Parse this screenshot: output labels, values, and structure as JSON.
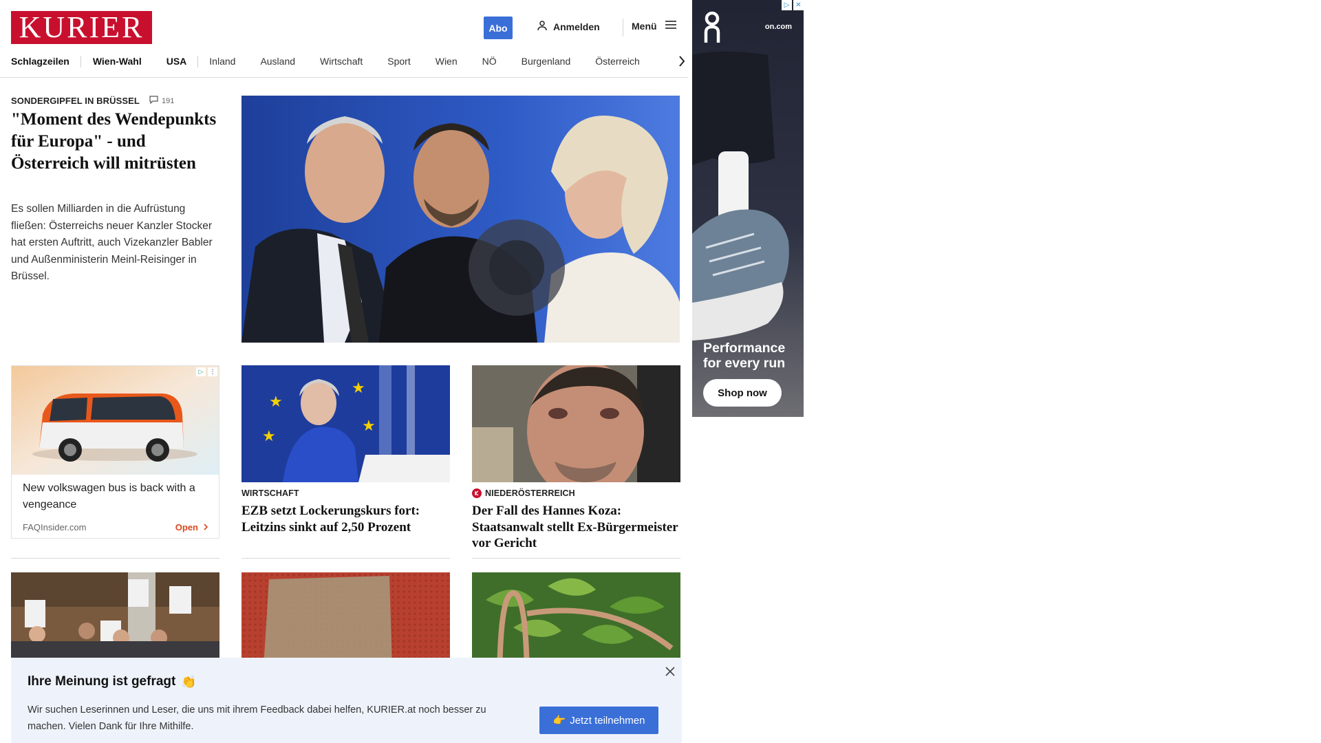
{
  "header": {
    "logo_text": "KURIER",
    "abo_label": "Abo",
    "login_label": "Anmelden",
    "menu_label": "Menü"
  },
  "nav": {
    "items": [
      "Schlagzeilen",
      "Wien-Wahl",
      "USA",
      "Inland",
      "Ausland",
      "Wirtschaft",
      "Sport",
      "Wien",
      "NÖ",
      "Burgenland",
      "Österreich"
    ]
  },
  "lead": {
    "kicker": "SONDERGIPFEL IN BRÜSSEL",
    "comment_count": "191",
    "title": "\"Moment des Wendepunkts für Europa\" - und Österreich will mitrüsten",
    "teaser": "Es sollen Milliarden in die Aufrüstung fließen: Österreichs neuer Kanzler Stocker hat ersten Auftritt, auch Vizekanzler Babler und Außenministerin Meinl-Reisinger in Brüssel.",
    "image": "eu-leaders-photo"
  },
  "native_ad": {
    "title": "New volkswagen bus is back with a vengeance",
    "source": "FAQInsider.com",
    "cta": "Open",
    "image": "orange-vw-bus-photo"
  },
  "cards": [
    {
      "kicker": "WIRTSCHAFT",
      "title": "EZB setzt Lockerungskurs fort: Leitzins sinkt auf 2,50 Prozent",
      "image": "ecb-president-photo"
    },
    {
      "kicker": "NIEDERÖSTERREICH",
      "title": "Der Fall des Hannes Koza: Staatsanwalt stellt Ex-Bürgermeister vor Gericht",
      "image": "man-selfie-photo"
    }
  ],
  "row3_images": [
    "protest-photo",
    "red-floor-photo",
    "tea-basket-photo"
  ],
  "banner_ad": {
    "brand": "On",
    "domain": "on.com",
    "headline": "Performance for every run",
    "cta": "Shop now"
  },
  "survey": {
    "title": "Ihre Meinung ist gefragt",
    "emoji": "👏",
    "text": "Wir suchen Leserinnen und Leser, die uns mit ihrem Feedback dabei helfen, KURIER.at noch besser zu machen. Vielen Dank für Ihre Mithilfe.",
    "button_label": "Jetzt teilnehmen",
    "button_emoji": "👉"
  },
  "colors": {
    "brand_red": "#c8102e",
    "accent_blue": "#3a6fd8",
    "survey_bg": "#eef3fb",
    "ad_cta_orange": "#d9461f"
  }
}
